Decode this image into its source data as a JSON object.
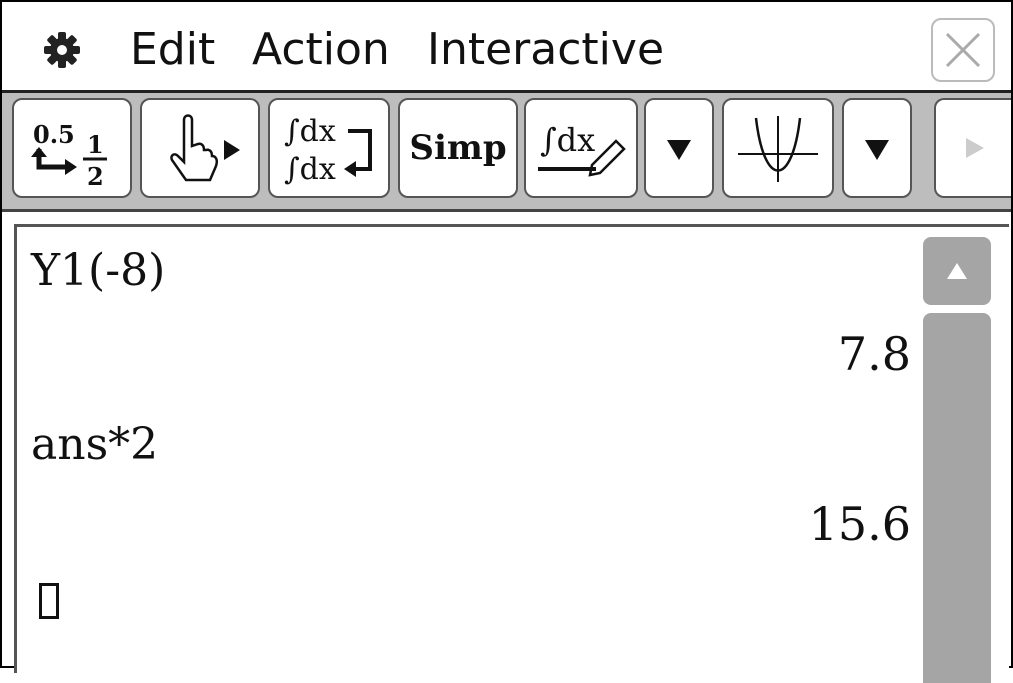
{
  "menu": {
    "settings_icon": "gear-icon",
    "items": [
      "Edit",
      "Action",
      "Interactive"
    ],
    "close_icon": "close-icon"
  },
  "toolbar": {
    "buttons": [
      {
        "name": "decimal-fraction-toggle",
        "icon": "decimal-fraction-icon",
        "top": "0.5",
        "frac_num": "1",
        "frac_den": "2"
      },
      {
        "name": "hand-tool",
        "icon": "hand-pointer-icon"
      },
      {
        "name": "integral-approx-toggle",
        "icon": "integral-exchange-icon",
        "label": "∫dx"
      },
      {
        "name": "simplify-button",
        "label": "Simp"
      },
      {
        "name": "integral-edit-button",
        "icon": "integral-pencil-icon",
        "label": "∫dx"
      },
      {
        "name": "dropdown-1",
        "icon": "triangle-down-icon"
      },
      {
        "name": "graph-button",
        "icon": "parabola-graph-icon"
      },
      {
        "name": "dropdown-2",
        "icon": "triangle-down-icon"
      },
      {
        "name": "toolbar-next",
        "icon": "triangle-right-icon"
      }
    ]
  },
  "work": {
    "entries": [
      {
        "expr": "Y1(-8)",
        "result": "7.8"
      },
      {
        "expr": "ans*2",
        "result": "15.6"
      }
    ]
  },
  "colors": {
    "toolbar_bg": "#bdbdbd",
    "scroll": "#a5a5a5"
  }
}
